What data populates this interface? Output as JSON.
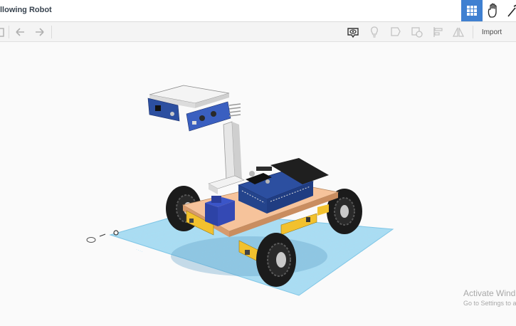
{
  "window": {
    "title": "llowing Robot"
  },
  "toolbar": {
    "import_label": "Import",
    "icons": [
      "copy-icon",
      "undo-icon",
      "redo-icon",
      "view-icon",
      "light-bulb-icon",
      "shape-note-icon",
      "shape-group-icon",
      "align-icon",
      "mirror-icon"
    ]
  },
  "top_actions": {
    "icons": [
      "grid-view-icon",
      "hand-icon",
      "tool-icon"
    ],
    "accent": "#3f80d1"
  },
  "scene": {
    "workplane_color": "#8fd1ef",
    "plate_color": "#f6c39b",
    "wheel_color": "#1b1b1b",
    "board_color": "#2c4fa0"
  },
  "watermark": {
    "line1": "Activate Wind",
    "line2": "Go to Settings to a"
  }
}
